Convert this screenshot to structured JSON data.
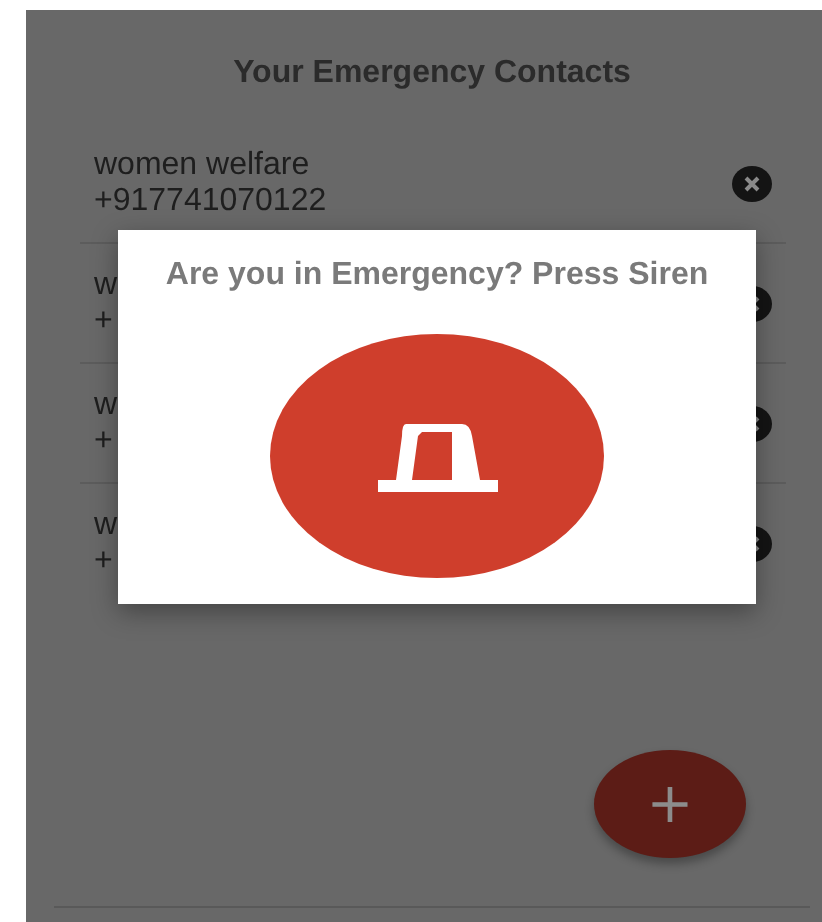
{
  "title": "Your Emergency Contacts",
  "contacts": [
    {
      "name": "women welfare",
      "phone": "+917741070122"
    },
    {
      "name": "w",
      "phone": "+"
    },
    {
      "name": "w",
      "phone": "+"
    },
    {
      "name": "w",
      "phone": "+"
    }
  ],
  "dialog": {
    "title": "Are you in Emergency? Press Siren"
  },
  "fab": {
    "label": "+"
  }
}
